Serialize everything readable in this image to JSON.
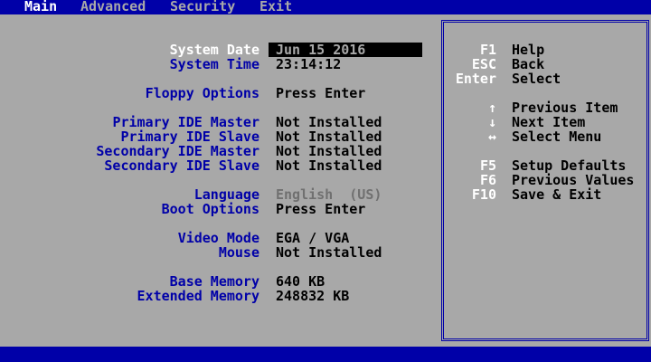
{
  "menu": [
    "Main",
    "Advanced",
    "Security",
    "Exit"
  ],
  "fields": [
    {
      "label": "System Date",
      "value": "Jun 15 2016"
    },
    {
      "label": "System Time",
      "value": "23:14:12"
    },
    {
      "label": "Floppy Options",
      "value": "Press Enter"
    },
    {
      "label": "Primary IDE Master",
      "value": "Not Installed"
    },
    {
      "label": "Primary IDE Slave",
      "value": "Not Installed"
    },
    {
      "label": "Secondary IDE Master",
      "value": "Not Installed"
    },
    {
      "label": "Secondary IDE Slave",
      "value": "Not Installed"
    },
    {
      "label": "Language",
      "value": "English  (US)"
    },
    {
      "label": "Boot Options",
      "value": "Press Enter"
    },
    {
      "label": "Video Mode",
      "value": "EGA / VGA"
    },
    {
      "label": "Mouse",
      "value": "Not Installed"
    },
    {
      "label": "Base Memory",
      "value": "640 KB"
    },
    {
      "label": "Extended Memory",
      "value": "248832 KB"
    }
  ],
  "help": [
    {
      "key": "F1",
      "desc": "Help"
    },
    {
      "key": "ESC",
      "desc": "Back"
    },
    {
      "key": "Enter",
      "desc": "Select"
    },
    {
      "key": "↑",
      "desc": "Previous Item"
    },
    {
      "key": "↓",
      "desc": "Next Item"
    },
    {
      "key": "↔",
      "desc": "Select Menu"
    },
    {
      "key": "F5",
      "desc": "Setup Defaults"
    },
    {
      "key": "F6",
      "desc": "Previous Values"
    },
    {
      "key": "F10",
      "desc": "Save & Exit"
    }
  ]
}
